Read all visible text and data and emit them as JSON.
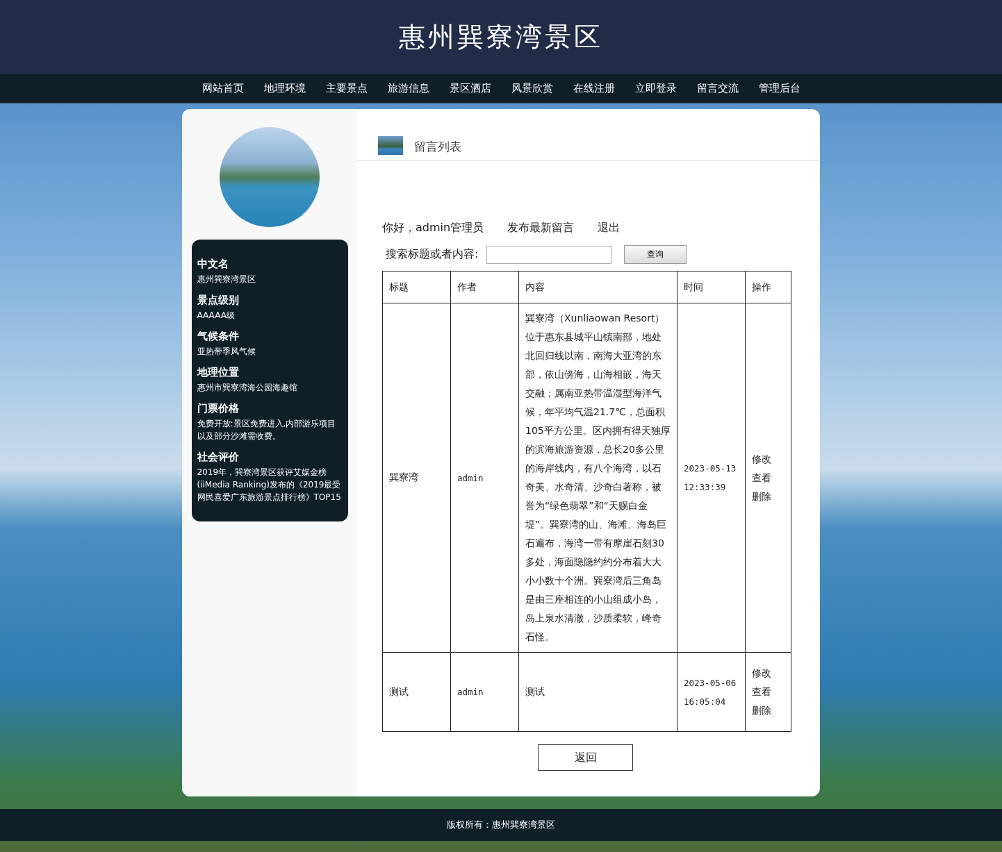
{
  "site_title": "惠州巽寮湾景区",
  "nav": [
    {
      "label": "网站首页"
    },
    {
      "label": "地理环境"
    },
    {
      "label": "主要景点"
    },
    {
      "label": "旅游信息"
    },
    {
      "label": "景区酒店"
    },
    {
      "label": "风景欣赏"
    },
    {
      "label": "在线注册"
    },
    {
      "label": "立即登录"
    },
    {
      "label": "留言交流"
    },
    {
      "label": "管理后台"
    }
  ],
  "sidebar": {
    "info": [
      {
        "heading": "中文名",
        "text": "惠州巽寮湾景区"
      },
      {
        "heading": "景点级别",
        "text": "AAAAA级"
      },
      {
        "heading": "气候条件",
        "text": "亚热带季风气候"
      },
      {
        "heading": "地理位置",
        "text": "惠州市巽寮湾海公园海趣馆"
      },
      {
        "heading": "门票价格",
        "text": "免费开放:景区免费进入,内部游乐项目以及部分沙滩需收费。"
      },
      {
        "heading": "社会评价",
        "text": "2019年，巽寮湾景区获评艾媒金榜(iiMedia Ranking)发布的《2019最受网民喜爱广东旅游景点排行榜》TOP15"
      }
    ]
  },
  "section_title": "留言列表",
  "user_bar": {
    "greeting": "你好，admin管理员",
    "links": [
      "发布最新留言",
      "退出"
    ]
  },
  "search": {
    "label": "搜索标题或者内容:",
    "button": "查询"
  },
  "table": {
    "columns": [
      "标题",
      "作者",
      "内容",
      "时间",
      "操作"
    ],
    "rows": [
      {
        "title": "巽寮湾",
        "author": "admin",
        "content": "巽寮湾（Xunliaowan Resort）位于惠东县城平山镇南部，地处北回归线以南，南海大亚湾的东部，依山傍海，山海相嵌，海天交融；属南亚热带温湿型海洋气候，年平均气温21.7℃，总面积105平方公里。区内拥有得天独厚的滨海旅游资源，总长20多公里的海岸线内，有八个海湾，以石奇美、水奇清、沙奇白著称，被誉为“绿色翡翠”和“天赐白金堤”。巽寮湾的山、海滩、海岛巨石遍布，海湾一带有摩崖石刻30多处，海面隐隐约约分布着大大小小数十个洲。巽寮湾后三角岛是由三座相连的小山组成小岛，岛上泉水清澈，沙质柔软，峰奇石怪。",
        "time": "2023-05-13 12:33:39",
        "actions": [
          "修改",
          "查看",
          "删除"
        ]
      },
      {
        "title": "测试",
        "author": "admin",
        "content": "测试",
        "time": "2023-05-06 16:05:04",
        "actions": [
          "修改",
          "查看",
          "删除"
        ]
      }
    ]
  },
  "back_button": "返回",
  "footer": "版权所有：惠州巽寮湾景区"
}
